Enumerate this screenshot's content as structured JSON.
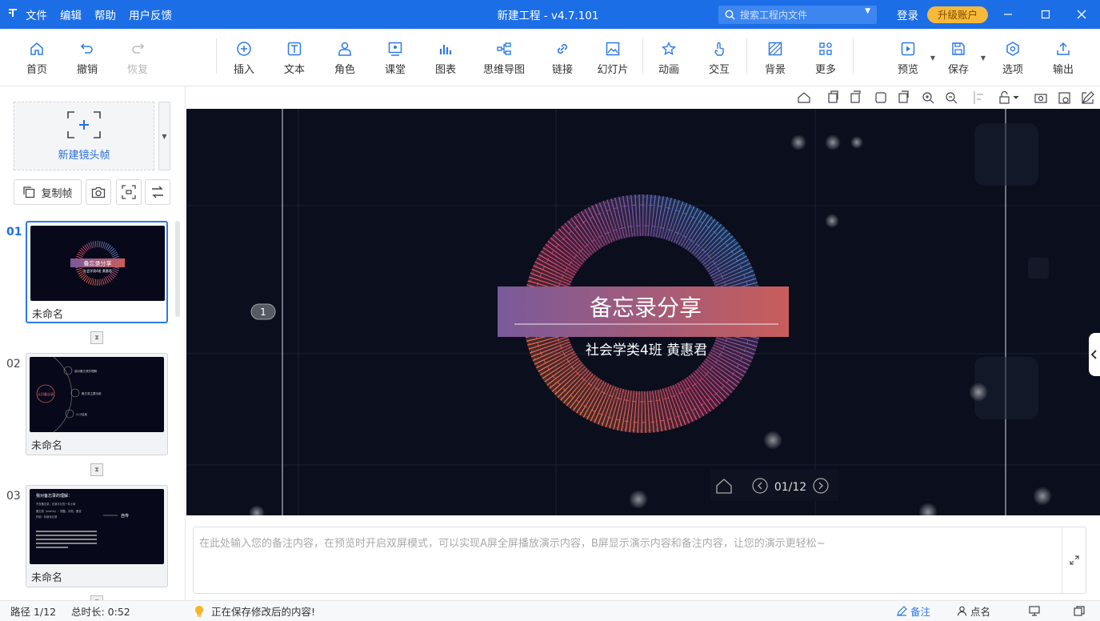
{
  "app": {
    "title": "新建工程 - v4.7.101",
    "menu": [
      "文件",
      "编辑",
      "帮助",
      "用户反馈"
    ],
    "search_placeholder": "搜索工程内文件",
    "login": "登录",
    "upgrade": "升级账户"
  },
  "toolbar": {
    "home": "首页",
    "undo": "撤销",
    "redo": "恢复",
    "insert": "插入",
    "text": "文本",
    "role": "角色",
    "classroom": "课堂",
    "chart": "图表",
    "mindmap": "思维导图",
    "link": "链接",
    "slide": "幻灯片",
    "animation": "动画",
    "interact": "交互",
    "background": "背景",
    "more": "更多",
    "preview": "预览",
    "save": "保存",
    "options": "选项",
    "export": "输出"
  },
  "sidebar": {
    "new_frame": "新建镜头帧",
    "copy_frame": "复制帧",
    "frames": [
      {
        "num": "01",
        "name": "未命名",
        "thumb_title": "备忘录分享",
        "thumb_sub": "社会学类4班   黄惠君"
      },
      {
        "num": "02",
        "name": "未命名",
        "thumb_center": "认识备忘录",
        "thumb_items": [
          "我对备忘录的理解",
          "备忘录主要功能",
          "小小结束"
        ]
      },
      {
        "num": "03",
        "name": "未命名",
        "thumb_title": "我对备忘录的理解：",
        "thumb_lines": [
          "不仅备忘录，记录平凡的一件小事",
          "备忘录（memo）：提醒，存档，备查",
          "作用：标准化记录"
        ],
        "thumb_arrow": "自传"
      }
    ]
  },
  "canvas": {
    "path_marker": "1",
    "title": "备忘录分享",
    "subtitle": "社会学类4班   黄惠君",
    "page_indicator": "01/12"
  },
  "notes": {
    "placeholder": "在此处输入您的备注内容，在预览时开启双屏模式，可以实现A屏全屏播放演示内容，B屏显示演示内容和备注内容，让您的演示更轻松~"
  },
  "status": {
    "path": "路径 1/12",
    "duration": "总时长: 0:52",
    "saving": "正在保存修改后的内容!",
    "notes_btn": "备注",
    "rollcall": "点名"
  },
  "colors": {
    "accent": "#1c6ee6",
    "upgrade": "#f8b93a",
    "canvas_bg": "#0a0e1d",
    "banner_left": "#7a5a9a",
    "banner_right": "#c85d5b"
  }
}
